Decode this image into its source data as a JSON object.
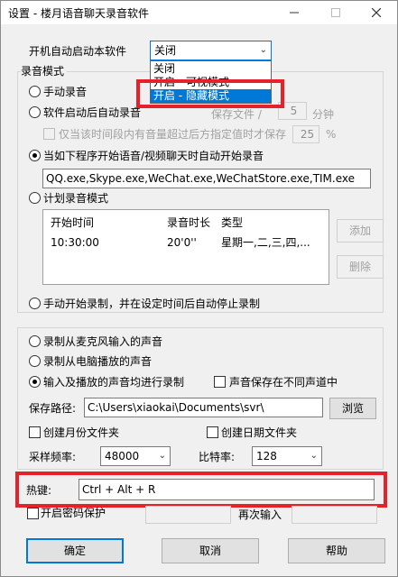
{
  "window": {
    "title": "设置 - 楼月语音聊天录音软件"
  },
  "autostart": {
    "label": "开机自动启动本软件",
    "selected": "关闭",
    "options": [
      "关闭",
      "开启 - 可视模式",
      "开启 - 隐藏模式"
    ]
  },
  "record_mode": {
    "title": "录音模式",
    "manual": "手动录音",
    "auto_on_start": "软件启动后自动录音",
    "save_file_label": "保存文件 /",
    "save_minutes": "5",
    "minutes_unit": "分钟",
    "volume_check_label": "仅当该时间段内有音量超过后方指定值时才保存",
    "volume_value": "25",
    "percent_unit": "%",
    "on_program_label": "当如下程序开始语音/视频聊天时自动开始录音",
    "programs": "QQ.exe,Skype.exe,WeChat.exe,WeChatStore.exe,TIM.exe",
    "plan_label": "计划录音模式",
    "plan_columns": [
      "开始时间",
      "录音时长",
      "类型"
    ],
    "plan_rows": [
      [
        "10:30:00",
        "20'0''",
        "星期一,二,三,四,..."
      ]
    ],
    "add_button": "添加",
    "delete_button": "删除",
    "manual_stop_label": "手动开始录制，并在设定时间后自动停止录制"
  },
  "source": {
    "mic": "录制从麦克风输入的声音",
    "pc": "录制从电脑播放的声音",
    "both": "输入及播放的声音均进行录制",
    "separate_channels": "声音保存在不同声道中",
    "save_path_label": "保存路径:",
    "save_path": "C:\\Users\\xiaokai\\Documents\\svr\\",
    "browse": "浏览",
    "month_folder": "创建月份文件夹",
    "date_folder": "创建日期文件夹",
    "sample_rate_label": "采样频率:",
    "sample_rate": "48000",
    "bitrate_label": "比特率:",
    "bitrate": "128"
  },
  "hotkey": {
    "label": "热键:",
    "value": "Ctrl + Alt + R"
  },
  "password": {
    "label": "开启密码保护",
    "repeat_label": "再次输入"
  },
  "buttons": {
    "ok": "确定",
    "cancel": "取消",
    "help": "帮助"
  },
  "colors": {
    "selection": "#0078d7",
    "highlight_box": "#e5222c"
  }
}
